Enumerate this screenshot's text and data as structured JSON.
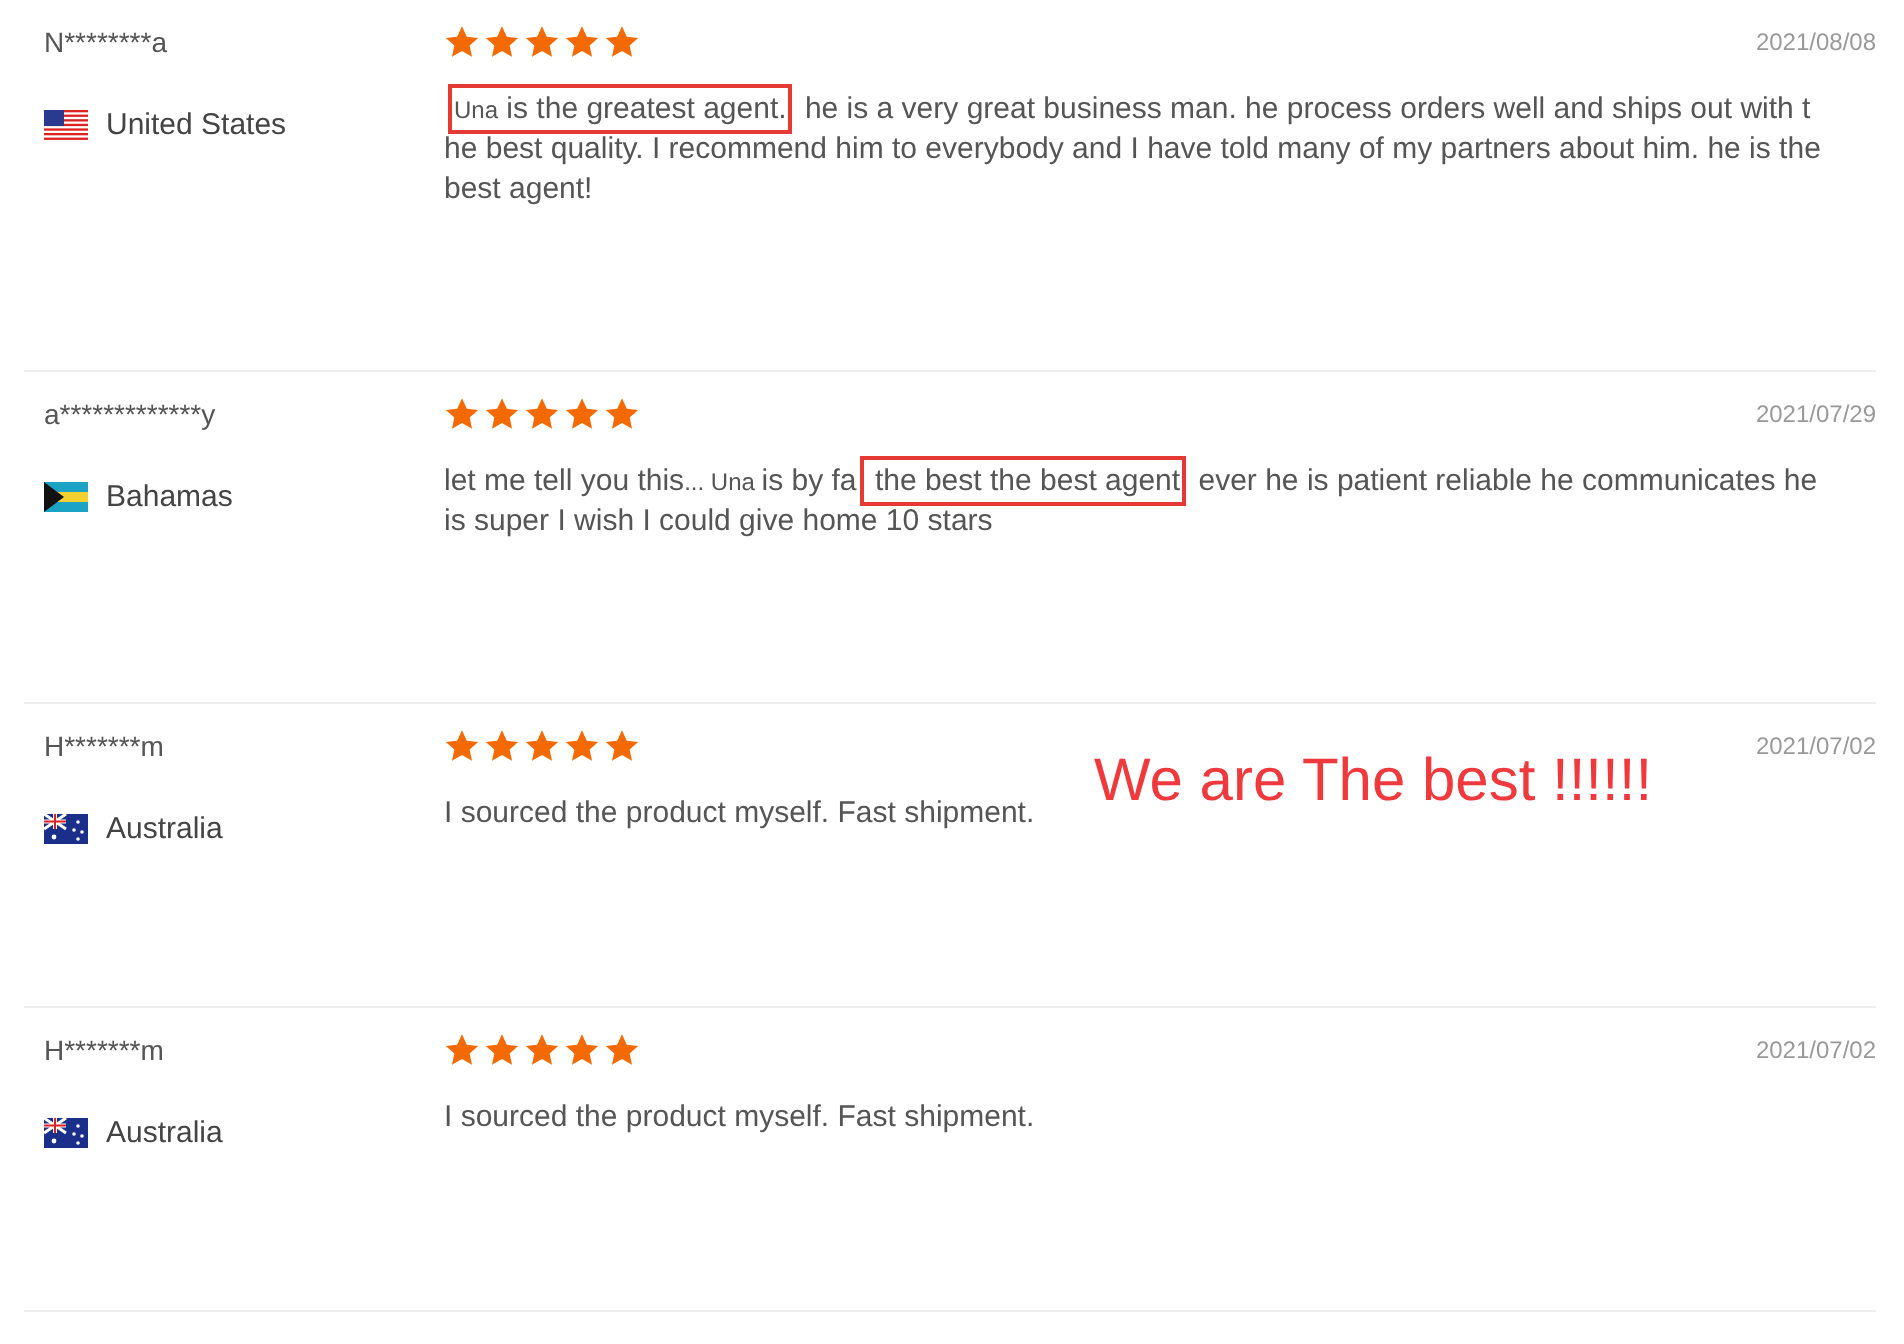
{
  "reviews": [
    {
      "name": "N********a",
      "kind": "us",
      "country": "United States",
      "stars": 5,
      "date": "2021/08/08",
      "segments": [
        {
          "text": "Una",
          "kind": "boxed_small"
        },
        {
          "text": "  is the greatest agent.",
          "kind": "boxed"
        },
        {
          "text": " he is a very great business man. he process orders well and ships out with the best quality. I recommend him to everybody and I have told many of my partners about him. he is the best agent!",
          "kind": "plain"
        }
      ]
    },
    {
      "name": "a*************y",
      "kind": "bs",
      "country": "Bahamas",
      "stars": 5,
      "date": "2021/07/29",
      "segments": [
        {
          "text": "let me tell you this",
          "kind": "plain"
        },
        {
          "text": "... Una ",
          "kind": "small"
        },
        {
          "text": " is by fa",
          "kind": "plain"
        },
        {
          "text": " the best the best agent",
          "kind": "boxed"
        },
        {
          "text": " ever he is patient reliable he communicates he is super I wish I could give home 10 stars",
          "kind": "plain"
        }
      ]
    },
    {
      "name": "H*******m",
      "kind": "au",
      "country": "Australia",
      "stars": 5,
      "date": "2021/07/02",
      "segments": [
        {
          "text": "I sourced the product myself. Fast shipment.",
          "kind": "plain"
        }
      ]
    },
    {
      "name": "H*******m",
      "kind": "au",
      "country": "Australia",
      "stars": 5,
      "date": "2021/07/02",
      "segments": [
        {
          "text": "I sourced the product myself. Fast shipment.",
          "kind": "plain"
        }
      ]
    }
  ],
  "annotation": {
    "text": "We are The best !!!!!!"
  }
}
